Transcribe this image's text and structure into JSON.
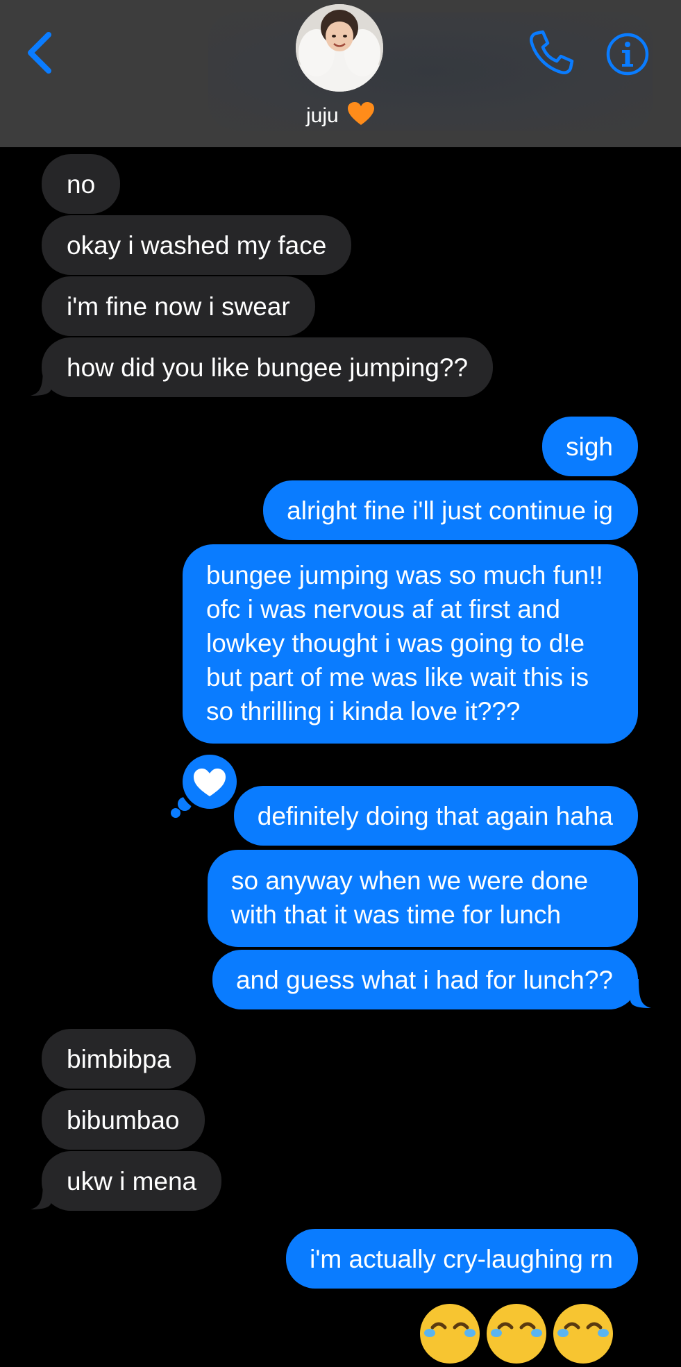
{
  "header": {
    "contact_name": "juju",
    "contact_emoji": "orange-heart",
    "back_icon": "chevron-left-icon",
    "call_icon": "phone-icon",
    "info_icon": "info-icon",
    "accent_color": "#0a7cff"
  },
  "messages": [
    {
      "from": "them",
      "text": "no"
    },
    {
      "from": "them",
      "text": "okay i washed my face"
    },
    {
      "from": "them",
      "text": "i'm fine now i swear"
    },
    {
      "from": "them",
      "text": "how did you like bungee jumping??"
    },
    {
      "from": "me",
      "text": "sigh"
    },
    {
      "from": "me",
      "text": "alright fine i'll just continue ig"
    },
    {
      "from": "me",
      "text": "bungee jumping was so much fun!! ofc i was nervous af at first and lowkey thought i was going to d!e but part of me was like wait this is so thrilling i kinda love it???"
    },
    {
      "from": "me",
      "text": "definitely doing that again haha",
      "tapback": "heart"
    },
    {
      "from": "me",
      "text": "so anyway when we were done with that it was time for lunch"
    },
    {
      "from": "me",
      "text": "and guess what i had for lunch??"
    },
    {
      "from": "them",
      "text": "bimbibpa"
    },
    {
      "from": "them",
      "text": "bibumbao"
    },
    {
      "from": "them",
      "text": "ukw i mena"
    },
    {
      "from": "me",
      "text": "i'm actually cry-laughing rn"
    },
    {
      "from": "me",
      "emoji": [
        "tears-of-joy",
        "tears-of-joy",
        "tears-of-joy"
      ]
    }
  ],
  "colors": {
    "incoming_bubble": "#262628",
    "outgoing_bubble": "#0a7cff",
    "background": "#000000",
    "header": "#3d3d3d"
  }
}
